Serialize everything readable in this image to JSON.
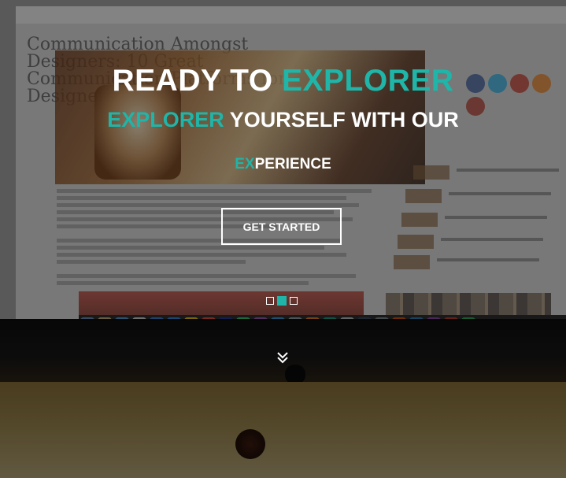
{
  "hero": {
    "title_part1": "READY TO ",
    "title_part2": "EXPLORER",
    "subtitle_part1": "EXPLORER",
    "subtitle_part2": " YOURSELF WITH OUR",
    "tag_part1": "EX",
    "tag_part2": "PERIENCE",
    "cta_label": "GET STARTED"
  },
  "background": {
    "article_title": "Communication Amongst Designers: 10 Great Communication Platforms for Designers"
  },
  "slider": {
    "slide_count": 3,
    "active_index": 1
  },
  "icons": {
    "scroll_down": "double-chevron-down-icon"
  },
  "colors": {
    "accent": "#1fb5a8",
    "text": "#ffffff",
    "overlay": "rgba(0,0,0,0.42)"
  }
}
